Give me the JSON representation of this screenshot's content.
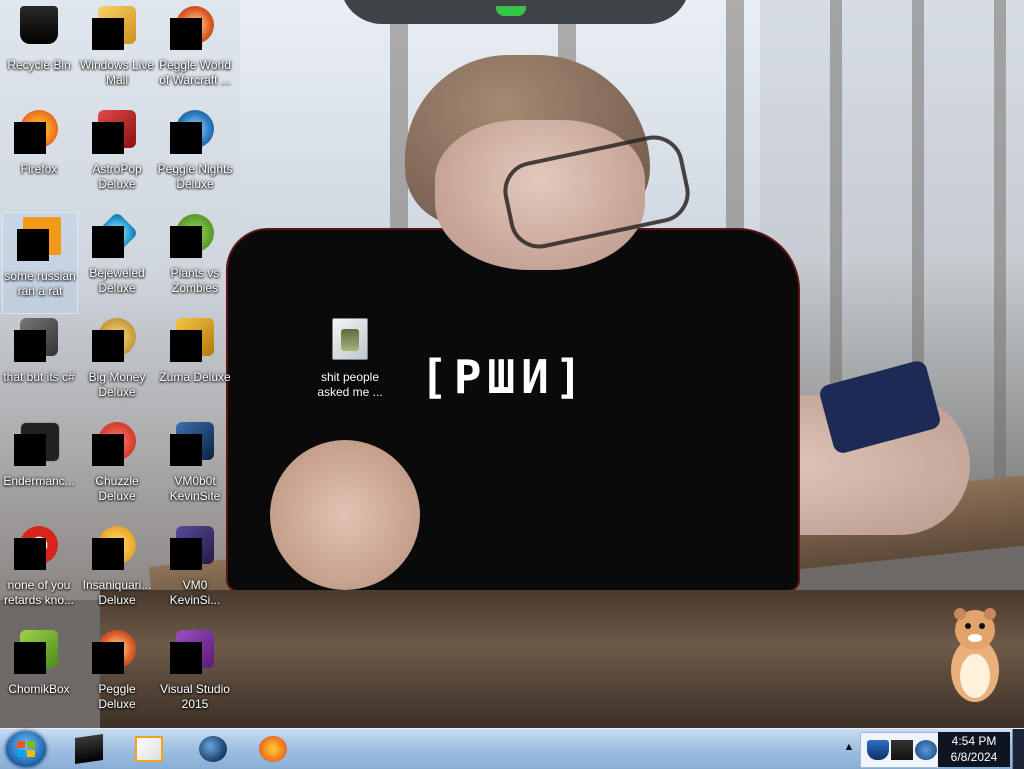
{
  "desktop": {
    "wallpaper_text": "[РШИ]",
    "icons": [
      {
        "label": "Recycle Bin",
        "icon": "recycle-bin-icon",
        "color": "#1b1b1b"
      },
      {
        "label": "Windows Live Mail",
        "icon": "mail-icon",
        "color": "#e0a72a"
      },
      {
        "label": "Peggle World of Warcraft ...",
        "icon": "peggle-icon",
        "color": "#d24b1f"
      },
      {
        "label": "Firefox",
        "icon": "firefox-icon",
        "color": "#f18b1c"
      },
      {
        "label": "AstroPop Deluxe",
        "icon": "astropop-icon",
        "color": "#c21f1f"
      },
      {
        "label": "Peggle Nights Deluxe",
        "icon": "peggle-icon",
        "color": "#2c7dc4"
      },
      {
        "label": "some russian ran a rat",
        "icon": "bsod-sticker-icon",
        "color": "#f29a17"
      },
      {
        "label": "Bejeweled Deluxe",
        "icon": "bejeweled-icon",
        "color": "#2aa3d8"
      },
      {
        "label": "Plants vs Zombies",
        "icon": "plants-vs-zombies-icon",
        "color": "#4d8a2a"
      },
      {
        "label": "that but its c#",
        "icon": "window-stack-icon",
        "color": "#4a4a4a"
      },
      {
        "label": "Big Money Deluxe",
        "icon": "money-icon",
        "color": "#c9932a"
      },
      {
        "label": "Zuma Deluxe",
        "icon": "zuma-icon",
        "color": "#d9a221"
      },
      {
        "label": "Endermanc...",
        "icon": "terminal-icon",
        "color": "#2a2a2a"
      },
      {
        "label": "Chuzzle Deluxe",
        "icon": "chuzzle-icon",
        "color": "#d93a2c"
      },
      {
        "label": "VM0b0t KevinSite",
        "icon": "vm-icon",
        "color": "#1f3c6a"
      },
      {
        "label": "none of you retards kno...",
        "icon": "opera-icon",
        "color": "#d6241a"
      },
      {
        "label": "Insaniquari... Deluxe",
        "icon": "insaniquarium-icon",
        "color": "#f0b41c"
      },
      {
        "label": "VM0 KevinSi...",
        "icon": "document-icon",
        "color": "#3b2a68"
      },
      {
        "label": "ChomikBox",
        "icon": "chomikbox-icon",
        "color": "#8ac43c"
      },
      {
        "label": "Peggle Deluxe",
        "icon": "peggle-icon",
        "color": "#d83b1f"
      },
      {
        "label": "Visual Studio 2015",
        "icon": "visual-studio-icon",
        "color": "#68217a"
      }
    ],
    "folder": {
      "label": "shit people asked me ...",
      "icon": "folder-icon"
    }
  },
  "taskbar": {
    "start_icon": "windows-start-icon",
    "pinned": [
      {
        "name": "terminal",
        "icon": "terminal-icon",
        "color": "#1a1a1a"
      },
      {
        "name": "media-player",
        "icon": "media-player-icon",
        "color": "#f2a21c"
      },
      {
        "name": "globe",
        "icon": "globe-icon",
        "color": "#1e3e66"
      },
      {
        "name": "firefox",
        "icon": "firefox-icon",
        "color": "#f0791c"
      }
    ],
    "tray_icons": [
      "security-shield-icon",
      "network-icon",
      "settings-icon"
    ],
    "clock": {
      "time": "4:54 PM",
      "date": "6/8/2024"
    }
  }
}
